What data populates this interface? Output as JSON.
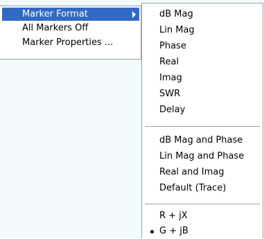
{
  "main_menu": {
    "items": [
      {
        "label": "Marker Format",
        "selected": true,
        "has_submenu": true
      },
      {
        "label": "All Markers Off"
      },
      {
        "label": "Marker Properties ..."
      }
    ]
  },
  "sub_menu": {
    "group1": [
      "dB Mag",
      "Lin Mag",
      "Phase",
      "Real",
      "Imag",
      "SWR",
      "Delay"
    ],
    "group2": [
      "dB Mag and Phase",
      "Lin Mag and Phase",
      "Real and Imag",
      "Default (Trace)"
    ],
    "group3": [
      "R + jX",
      "G + jB"
    ],
    "checked_item": "G + jB"
  },
  "colors": {
    "selection": "#316ac5",
    "background": "#f1fbfb",
    "menu_border": "#9aa0a6"
  },
  "icons": {
    "submenu_arrow": "chevron-right-icon",
    "checked": "radio-bullet-icon"
  }
}
